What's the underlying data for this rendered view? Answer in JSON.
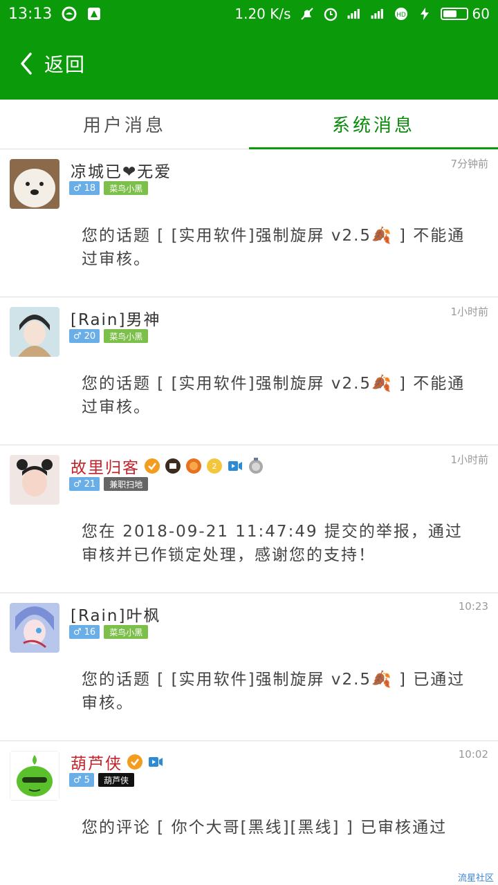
{
  "status": {
    "time": "13:13",
    "speed": "1.20 K/s",
    "battery": "60",
    "battery_level": 0.6
  },
  "header": {
    "back_label": "返回"
  },
  "tabs": [
    {
      "label": "用户消息"
    },
    {
      "label": "系统消息"
    }
  ],
  "messages": [
    {
      "name": "凉城已❤无爱",
      "time": "7分钟前",
      "gender": "♂",
      "level": "18",
      "role": "菜鸟小黑",
      "role_color": "#7cc04b",
      "avatar_color": "#c69a6b",
      "text": "您的话题 [ [实用软件]强制旋屏 v2.5🍂 ] 不能通过审核。"
    },
    {
      "name": "[Rain]男神",
      "time": "1小时前",
      "gender": "♂",
      "level": "20",
      "role": "菜鸟小黑",
      "role_color": "#7cc04b",
      "avatar_color": "#b9d8e0",
      "text": "您的话题 [ [实用软件]强制旋屏 v2.5🍂 ] 不能通过审核。"
    },
    {
      "name": "故里归客",
      "time": "1小时前",
      "gender": "♂",
      "level": "21",
      "role": "兼职扫地",
      "role_color": "#666666",
      "avatar_color": "#e9cfc7",
      "text": "您在 2018-09-21 11:47:49 提交的举报，通过审核并已作锁定处理，感谢您的支持！"
    },
    {
      "name": "[Rain]叶枫",
      "time": "10:23",
      "gender": "♂",
      "level": "16",
      "role": "菜鸟小黑",
      "role_color": "#7cc04b",
      "avatar_color": "#8fa6d8",
      "text": "您的话题 [ [实用软件]强制旋屏 v2.5🍂 ] 已通过审核。"
    },
    {
      "name": "葫芦侠",
      "time": "10:02",
      "gender": "♂",
      "level": "5",
      "role": "葫芦侠",
      "role_color": "#111111",
      "avatar_color": "#5ac02b",
      "text": "您的评论 [ 你个大哥[黑线][黑线] ] 已审核通过"
    }
  ],
  "watermark": "流星社区",
  "colors": {
    "brand_green": "#0a9a0a",
    "tab_active": "#0a8a0a"
  }
}
